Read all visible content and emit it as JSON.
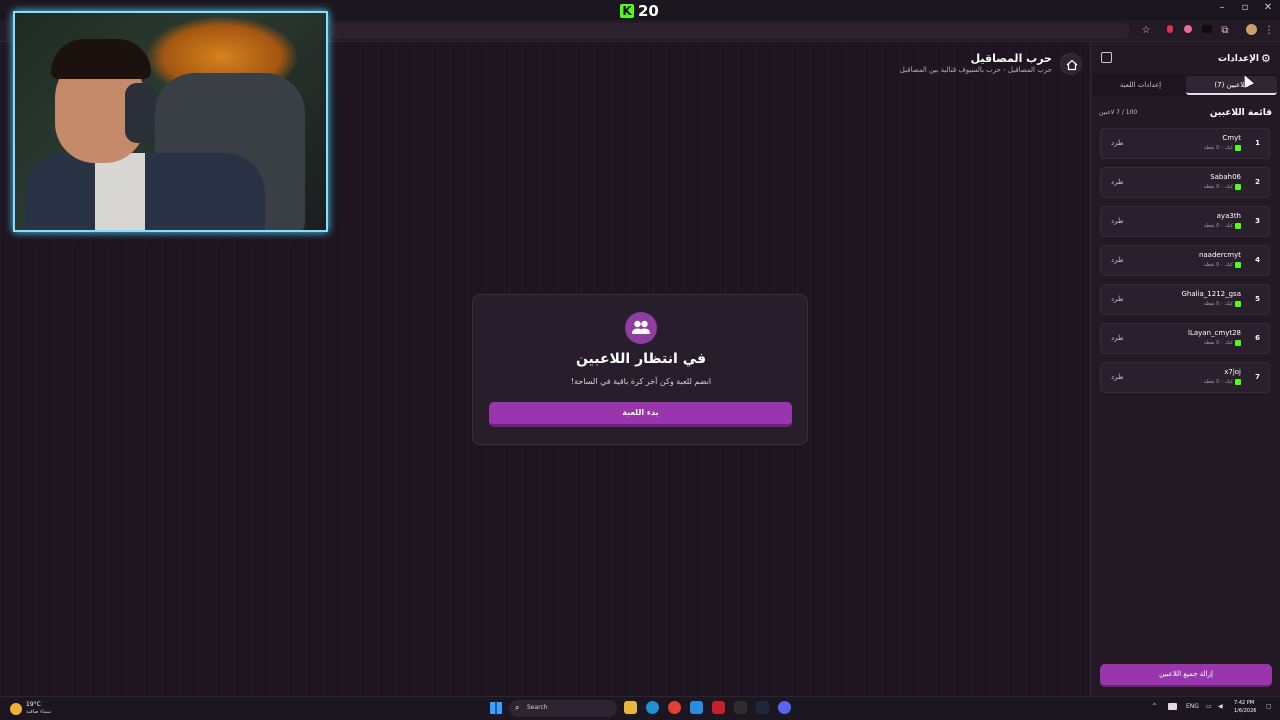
{
  "browser": {
    "kick_count": "20",
    "kick_logo": "K"
  },
  "page": {
    "title": "حرب المصاقيل",
    "subtitle": "حرب المصاقيل - حرب بالسيوف قتالية بين المصاقيل"
  },
  "waiting_card": {
    "title": "في انتظار اللاعبين",
    "subtitle": "انضم للعبة وكن آخر كرة باقية في الساحة!",
    "start_button": "بدء اللعبة"
  },
  "sidebar": {
    "title": "الإعدادات",
    "tabs": [
      {
        "label": "اللاعبين (7)",
        "active": true
      },
      {
        "label": "إعدادات اللعبة",
        "active": false
      }
    ],
    "list_title": "قائمة اللاعبين",
    "list_count": "100 / 7 لاعبين",
    "players": [
      {
        "num": "1",
        "name": "Cmyt",
        "platform": "كيك",
        "points": "0 نقطة",
        "kick": "طرد"
      },
      {
        "num": "2",
        "name": "Sabah06",
        "platform": "كيك",
        "points": "0 نقطة",
        "kick": "طرد"
      },
      {
        "num": "3",
        "name": "aya3th",
        "platform": "كيك",
        "points": "0 نقطة",
        "kick": "طرد"
      },
      {
        "num": "4",
        "name": "naadercmyt",
        "platform": "كيك",
        "points": "0 نقطة",
        "kick": "طرد"
      },
      {
        "num": "5",
        "name": "Ghalia_1212_gsa",
        "platform": "كيك",
        "points": "0 نقطة",
        "kick": "طرد"
      },
      {
        "num": "6",
        "name": "lLayan_cmyt28",
        "platform": "كيك",
        "points": "0 نقطة",
        "kick": "طرد"
      },
      {
        "num": "7",
        "name": "x7joj",
        "platform": "كيك",
        "points": "0 نقطة",
        "kick": "طرد"
      }
    ],
    "remove_all": "إزالة جميع اللاعبين"
  },
  "taskbar": {
    "temperature": "19°C",
    "weather": "سماء صافية",
    "search_label": "Search",
    "lang": "ENG",
    "time": "7:42 PM",
    "date": "1/6/2026"
  },
  "colors": {
    "accent": "#9a36ad",
    "kick_green": "#53fc18",
    "background": "#1e1520",
    "webcam_border": "#7fe3ff"
  }
}
